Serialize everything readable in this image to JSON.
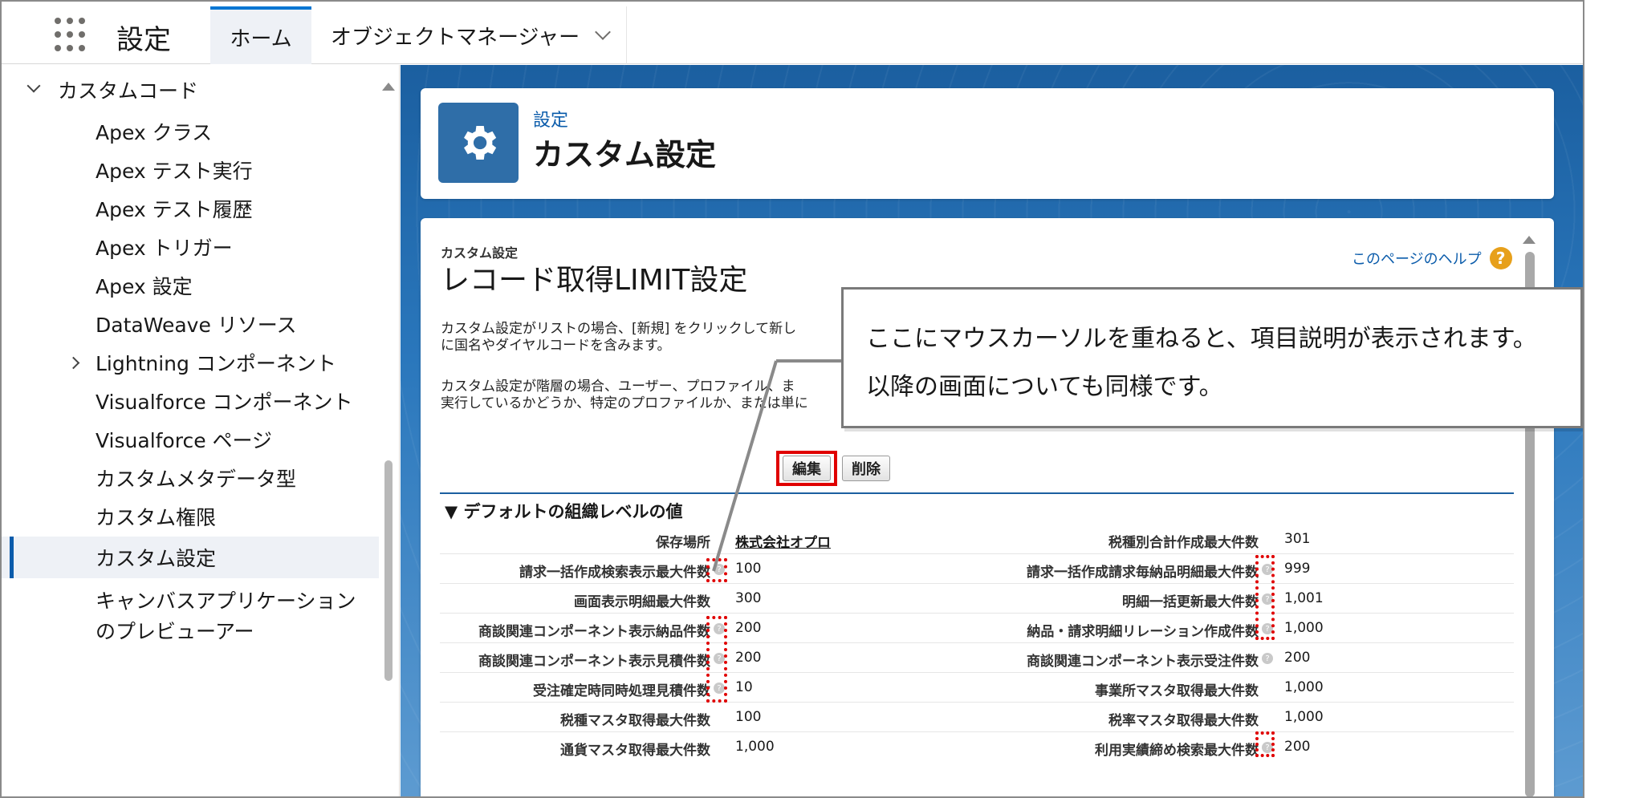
{
  "topnav": {
    "app_name": "設定",
    "tabs": [
      {
        "label": "ホーム"
      },
      {
        "label": "オブジェクトマネージャー"
      }
    ]
  },
  "sidebar": {
    "section": "カスタムコード",
    "items": [
      {
        "label": "Apex クラス"
      },
      {
        "label": "Apex テスト実行"
      },
      {
        "label": "Apex テスト履歴"
      },
      {
        "label": "Apex トリガー"
      },
      {
        "label": "Apex 設定"
      },
      {
        "label": "DataWeave リソース"
      },
      {
        "label": "Lightning コンポーネント"
      },
      {
        "label": "Visualforce コンポーネント"
      },
      {
        "label": "Visualforce ページ"
      },
      {
        "label": "カスタムメタデータ型"
      },
      {
        "label": "カスタム権限"
      },
      {
        "label": "カスタム設定"
      },
      {
        "label_line1": "キャンバスアプリケーション",
        "label_line2": "のプレビューアー"
      }
    ]
  },
  "header": {
    "breadcrumb": "設定",
    "title": "カスタム設定"
  },
  "content": {
    "subtitle": "カスタム設定",
    "title": "レコード取得LIMIT設定",
    "help_link": "このページのヘルプ",
    "desc_1_line1": "カスタム設定がリストの場合、[新規] をクリックして新し",
    "desc_1_line2": "に国名やダイヤルコードを含みます。",
    "desc_2_line1": "カスタム設定が階層の場合、ユーザー、プロファイル、ま",
    "desc_2_line2": "実行しているかどうか、特定のプロファイルか、または単に",
    "edit_button": "編集",
    "delete_button": "削除",
    "section_title": "▼ デフォルトの組織レベルの値",
    "rows": [
      {
        "label1": "保存場所",
        "value1": "株式会社オプロ",
        "label2": "税種別合計作成最大件数",
        "value2": "301"
      },
      {
        "label1": "請求一括作成検索表示最大件数",
        "value1": "100",
        "label2": "請求一括作成請求毎納品明細最大件数",
        "value2": "999"
      },
      {
        "label1": "画面表示明細最大件数",
        "value1": "300",
        "label2": "明細一括更新最大件数",
        "value2": "1,001"
      },
      {
        "label1": "商談関連コンポーネント表示納品件数",
        "value1": "200",
        "label2": "納品・請求明細リレーション作成件数",
        "value2": "1,000"
      },
      {
        "label1": "商談関連コンポーネント表示見積件数",
        "value1": "200",
        "label2": "商談関連コンポーネント表示受注件数",
        "value2": "200"
      },
      {
        "label1": "受注確定時同時処理見積件数",
        "value1": "10",
        "label2": "事業所マスタ取得最大件数",
        "value2": "1,000"
      },
      {
        "label1": "税種マスタ取得最大件数",
        "value1": "100",
        "label2": "税率マスタ取得最大件数",
        "value2": "1,000"
      },
      {
        "label1": "通貨マスタ取得最大件数",
        "value1": "1,000",
        "label2": "利用実績締め検索最大件数",
        "value2": "200"
      }
    ]
  },
  "callout": {
    "line1": "ここにマウスカーソルを重ねると、項目説明が表示されます。",
    "line2": "以降の画面についても同様です。"
  },
  "colors": {
    "accent": "#0176d3",
    "highlight": "#e00000",
    "header_icon": "#2f6ea8"
  }
}
